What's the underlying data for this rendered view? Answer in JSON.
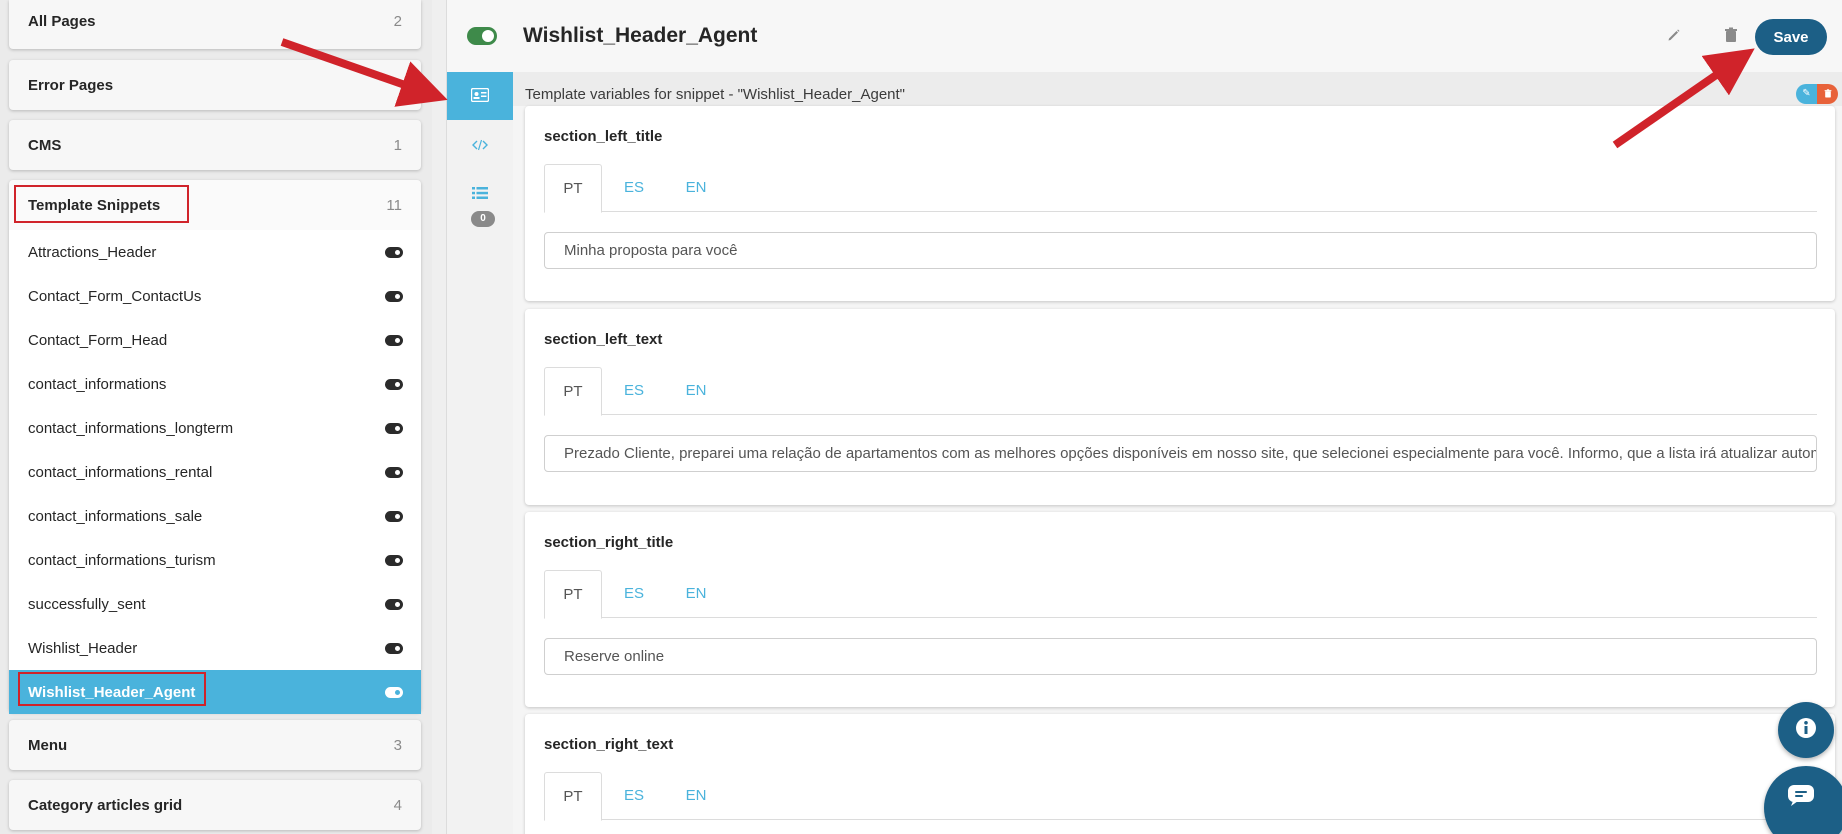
{
  "sidebar": {
    "groups": {
      "all_pages": {
        "title": "All Pages",
        "count": "2"
      },
      "error_pages": {
        "title": "Error Pages",
        "count": ""
      },
      "cms": {
        "title": "CMS",
        "count": "1"
      },
      "template_snippets": {
        "title": "Template Snippets",
        "count": "11"
      },
      "menu": {
        "title": "Menu",
        "count": "3"
      },
      "category_articles": {
        "title": "Category articles grid",
        "count": "4"
      }
    },
    "snippets": [
      {
        "label": "Attractions_Header",
        "enabled": true
      },
      {
        "label": "Contact_Form_ContactUs",
        "enabled": true
      },
      {
        "label": "Contact_Form_Head",
        "enabled": true
      },
      {
        "label": "contact_informations",
        "enabled": true
      },
      {
        "label": "contact_informations_longterm",
        "enabled": true
      },
      {
        "label": "contact_informations_rental",
        "enabled": true
      },
      {
        "label": "contact_informations_sale",
        "enabled": true
      },
      {
        "label": "contact_informations_turism",
        "enabled": true
      },
      {
        "label": "successfully_sent",
        "enabled": true
      },
      {
        "label": "Wishlist_Header",
        "enabled": true
      },
      {
        "label": "Wishlist_Header_Agent",
        "enabled": true,
        "selected": true
      }
    ]
  },
  "header": {
    "title": "Wishlist_Header_Agent",
    "save_label": "Save",
    "enabled": true
  },
  "rail": {
    "badge": "0"
  },
  "subheader": {
    "text": "Template variables for snippet - \"Wishlist_Header_Agent\""
  },
  "tabs": {
    "pt": "PT",
    "es": "ES",
    "en": "EN"
  },
  "cards": [
    {
      "name": "section_left_title",
      "active_tab": "PT",
      "value": "Minha proposta para você"
    },
    {
      "name": "section_left_text",
      "active_tab": "PT",
      "value": "Prezado Cliente, preparei uma relação de apartamentos com as melhores opções disponíveis em nosso site, que selecionei especialmente para você. Informo, que a lista irá atualizar automaticamente"
    },
    {
      "name": "section_right_title",
      "active_tab": "PT",
      "value": "Reserve online"
    },
    {
      "name": "section_right_text",
      "active_tab": "PT",
      "value": ""
    }
  ],
  "colors": {
    "accent": "#4ab3dc",
    "primary": "#1c5f86",
    "toggle_on": "#3e8a4a",
    "annotation_red": "#d0232a",
    "danger": "#e8623a"
  },
  "icons": [
    "pencil-icon",
    "trash-icon",
    "id-card-icon",
    "code-icon",
    "list-icon",
    "info-icon",
    "chat-icon"
  ]
}
